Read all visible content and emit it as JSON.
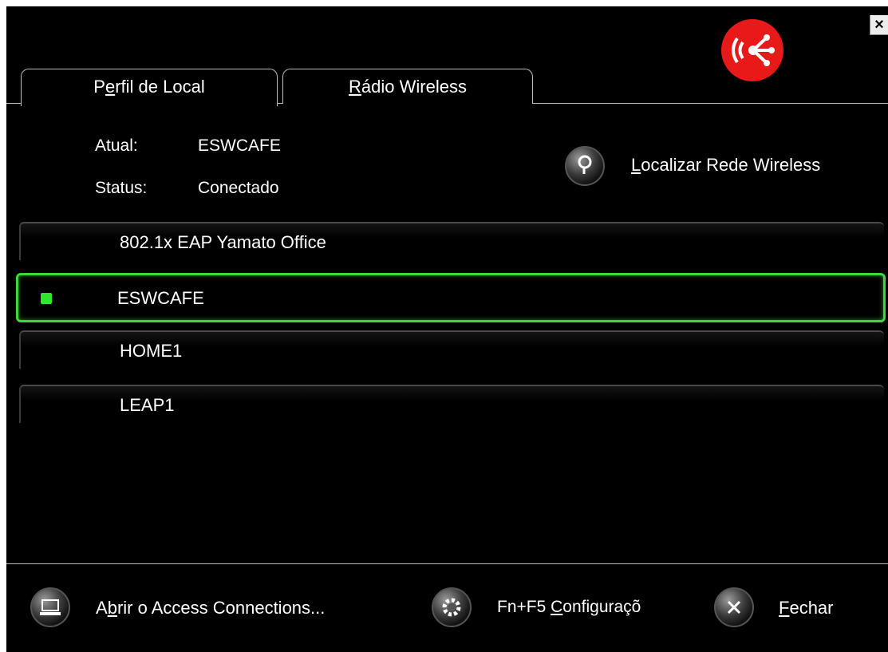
{
  "window": {
    "close_label": "×",
    "accent_color": "#e81919",
    "logo_icon": "wireless-broadcast-icon"
  },
  "tabs": [
    {
      "label_pre": "P",
      "label_u": "e",
      "label_post": "rfil de Local",
      "active": true
    },
    {
      "label_pre": "",
      "label_u": "R",
      "label_post": "ádio Wireless",
      "active": false
    }
  ],
  "status": {
    "atual_label": "Atual:",
    "atual_value": "ESWCAFE",
    "status_label": "Status:",
    "status_value": "Conectado"
  },
  "locate": {
    "label_u": "L",
    "label_rest": "ocalizar Rede Wireless",
    "icon": "search-icon"
  },
  "profiles": [
    {
      "name": "802.1x EAP Yamato Office",
      "active": false
    },
    {
      "name": "ESWCAFE",
      "active": true
    },
    {
      "name": "HOME1",
      "active": false
    },
    {
      "name": "LEAP1",
      "active": false
    }
  ],
  "active_color": "#2ee82e",
  "footer": {
    "open_pre": "A",
    "open_u": "b",
    "open_post": "rir o Access Connections...",
    "config_pre": "Fn+F5 ",
    "config_u": "C",
    "config_post": "onfiguraçõ",
    "close_u": "F",
    "close_post": "echar"
  }
}
